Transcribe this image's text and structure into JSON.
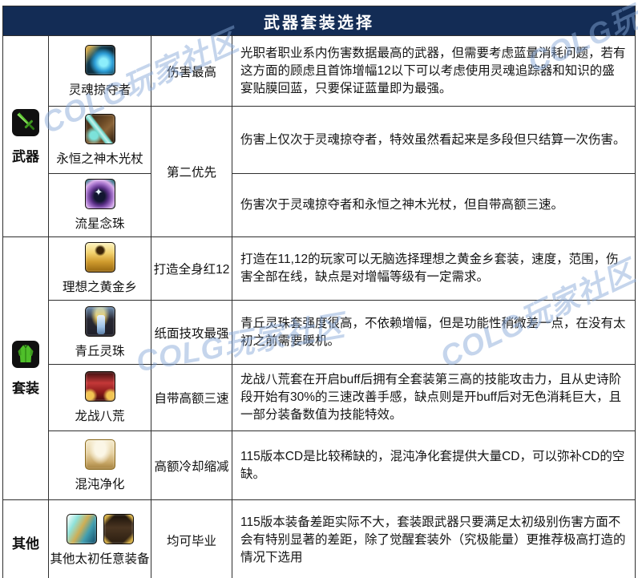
{
  "title": "武器套装选择",
  "watermark": "COLG玩家社区",
  "colors": {
    "header_bg": "#132c55",
    "header_text": "#ffffff",
    "border": "#2f2f2f",
    "watermark_blue": "#86a8d8",
    "category_green": "#55c22e"
  },
  "categories": [
    {
      "label": "武器",
      "icon": "sword-icon"
    },
    {
      "label": "套装",
      "icon": "jacket-icon"
    },
    {
      "label": "其他",
      "icon": "none"
    }
  ],
  "rows": [
    {
      "item": "灵魂掠夺者",
      "icon": "soul-plunderer-icon",
      "tag": "伤害最高",
      "desc": "光职者职业系内伤害数据最高的武器，但需要考虑蓝量消耗问题，若有这方面的顾虑且首饰增幅12以下可以考虑使用灵魂追踪器和知识的盛宴贴膜回蓝，只要保证蓝量即为最强。"
    },
    {
      "item": "永恒之神木光杖",
      "icon": "eternal-staff-icon",
      "tag": "第二优先",
      "desc": "伤害上仅次于灵魂掠夺者，特效虽然看起来是多段但只结算一次伤害。"
    },
    {
      "item": "流星念珠",
      "icon": "meteor-beads-icon",
      "desc": "伤害次于灵魂掠夺者和永恒之神木光杖，但自带高额三速。"
    },
    {
      "item": "理想之黄金乡",
      "icon": "golden-land-icon",
      "tag": "打造全身红12",
      "desc": "打造在11,12的玩家可以无脑选择理想之黄金乡套装，速度，范围，伤害全部在线，缺点是对增幅等级有一定需求。"
    },
    {
      "item": "青丘灵珠",
      "icon": "qingqiu-pearl-icon",
      "tag": "纸面技攻最强",
      "desc": "青丘灵珠套强度很高，不依赖增幅，但是功能性稍微差一点，在没有太初之前需要暖机。"
    },
    {
      "item": "龙战八荒",
      "icon": "dragon-war-icon",
      "tag": "自带高额三速",
      "desc": "龙战八荒套在开启buff后拥有全套装第三高的技能攻击力，且从史诗阶段开始有30%的三速改善手感，缺点则是开buff后对无色消耗巨大，且一部分装备数值为技能特效。"
    },
    {
      "item": "混沌净化",
      "icon": "chaos-purify-icon",
      "tag": "高额冷却缩减",
      "desc": "115版本CD是比较稀缺的，混沌净化套提供大量CD，可以弥补CD的空缺。"
    },
    {
      "item": "其他太初任意装备",
      "icons": [
        "taichu-crystal-icon",
        "taichu-suit-icon"
      ],
      "tag": "均可毕业",
      "desc": "115版本装备差距实际不大，套装跟武器只要满足太初级别伤害方面不会有特别显著的差距，除了觉醒套装外（究极能量）更推荐极高打造的情况下选用"
    }
  ]
}
